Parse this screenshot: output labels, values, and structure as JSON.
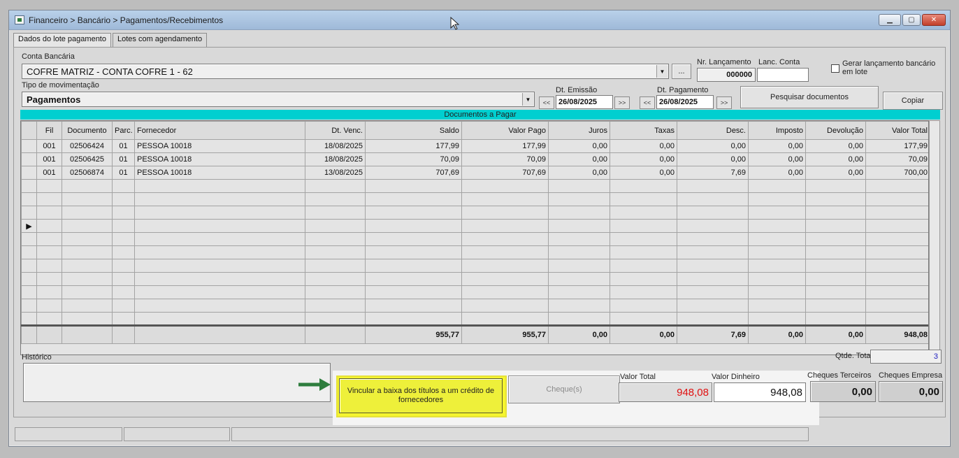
{
  "window": {
    "title": "Financeiro > Bancário > Pagamentos/Recebimentos",
    "controls": [
      "minimize",
      "maximize",
      "close"
    ]
  },
  "tabs": [
    {
      "label": "Dados do lote pagamento",
      "active": true
    },
    {
      "label": "Lotes com agendamento",
      "active": false
    }
  ],
  "form": {
    "conta_bancaria_label": "Conta Bancária",
    "conta_bancaria_value": "COFRE MATRIZ - CONTA COFRE 1 - 62",
    "ellipsis_label": "...",
    "nr_lancamento_label": "Nr. Lançamento",
    "nr_lancamento_value": "000000",
    "lanc_conta_label": "Lanc. Conta",
    "lanc_conta_value": "",
    "gerar_lancamento_label": "Gerar lançamento bancário em lote",
    "tipo_mov_label": "Tipo de movimentação",
    "tipo_mov_value": "Pagamentos",
    "dt_emissao_label": "Dt. Emissão",
    "dt_emissao_value": "26/08/2025",
    "dt_pagamento_label": "Dt. Pagamento",
    "dt_pagamento_value": "26/08/2025",
    "prev_label": "<<",
    "next_label": ">>",
    "pesquisar_label": "Pesquisar documentos",
    "copiar_label": "Copiar"
  },
  "grid": {
    "title": "Documentos a Pagar",
    "columns": [
      "Fil",
      "Documento",
      "Parc.",
      "Fornecedor",
      "Dt. Venc.",
      "Saldo",
      "Valor Pago",
      "Juros",
      "Taxas",
      "Desc.",
      "Imposto",
      "Devolução",
      "Valor Total"
    ],
    "rows": [
      [
        "001",
        "02506424",
        "01",
        "PESSOA 10018",
        "18/08/2025",
        "177,99",
        "177,99",
        "0,00",
        "0,00",
        "0,00",
        "0,00",
        "0,00",
        "177,99"
      ],
      [
        "001",
        "02506425",
        "01",
        "PESSOA 10018",
        "18/08/2025",
        "70,09",
        "70,09",
        "0,00",
        "0,00",
        "0,00",
        "0,00",
        "0,00",
        "70,09"
      ],
      [
        "001",
        "02506874",
        "01",
        "PESSOA 10018",
        "13/08/2025",
        "707,69",
        "707,69",
        "0,00",
        "0,00",
        "7,69",
        "0,00",
        "0,00",
        "700,00"
      ]
    ],
    "current_row_marker": "▶",
    "totals": [
      "",
      "",
      "",
      "",
      "",
      "955,77",
      "955,77",
      "0,00",
      "0,00",
      "7,69",
      "0,00",
      "0,00",
      "948,08"
    ]
  },
  "footer": {
    "historico_label": "Histórico",
    "qtde_total_label": "Qtde. Total",
    "qtde_total_value": "3",
    "vincular_label": "Vincular a baixa dos títulos a um crédito de fornecedores",
    "cheques_label": "Cheque(s)",
    "valor_total_label": "Valor Total",
    "valor_total_value": "948,08",
    "valor_dinheiro_label": "Valor Dinheiro",
    "valor_dinheiro_value": "948,08",
    "cheques_terceiros_label": "Cheques Terceiros",
    "cheques_terceiros_value": "0,00",
    "cheques_empresa_label": "Cheques Empresa",
    "cheques_empresa_value": "0,00"
  },
  "colors": {
    "grid_header_bar": "#00cfd0",
    "highlight": "#f5f52e",
    "arrow": "#2e7d3e",
    "valor_total_text": "#e01010"
  }
}
